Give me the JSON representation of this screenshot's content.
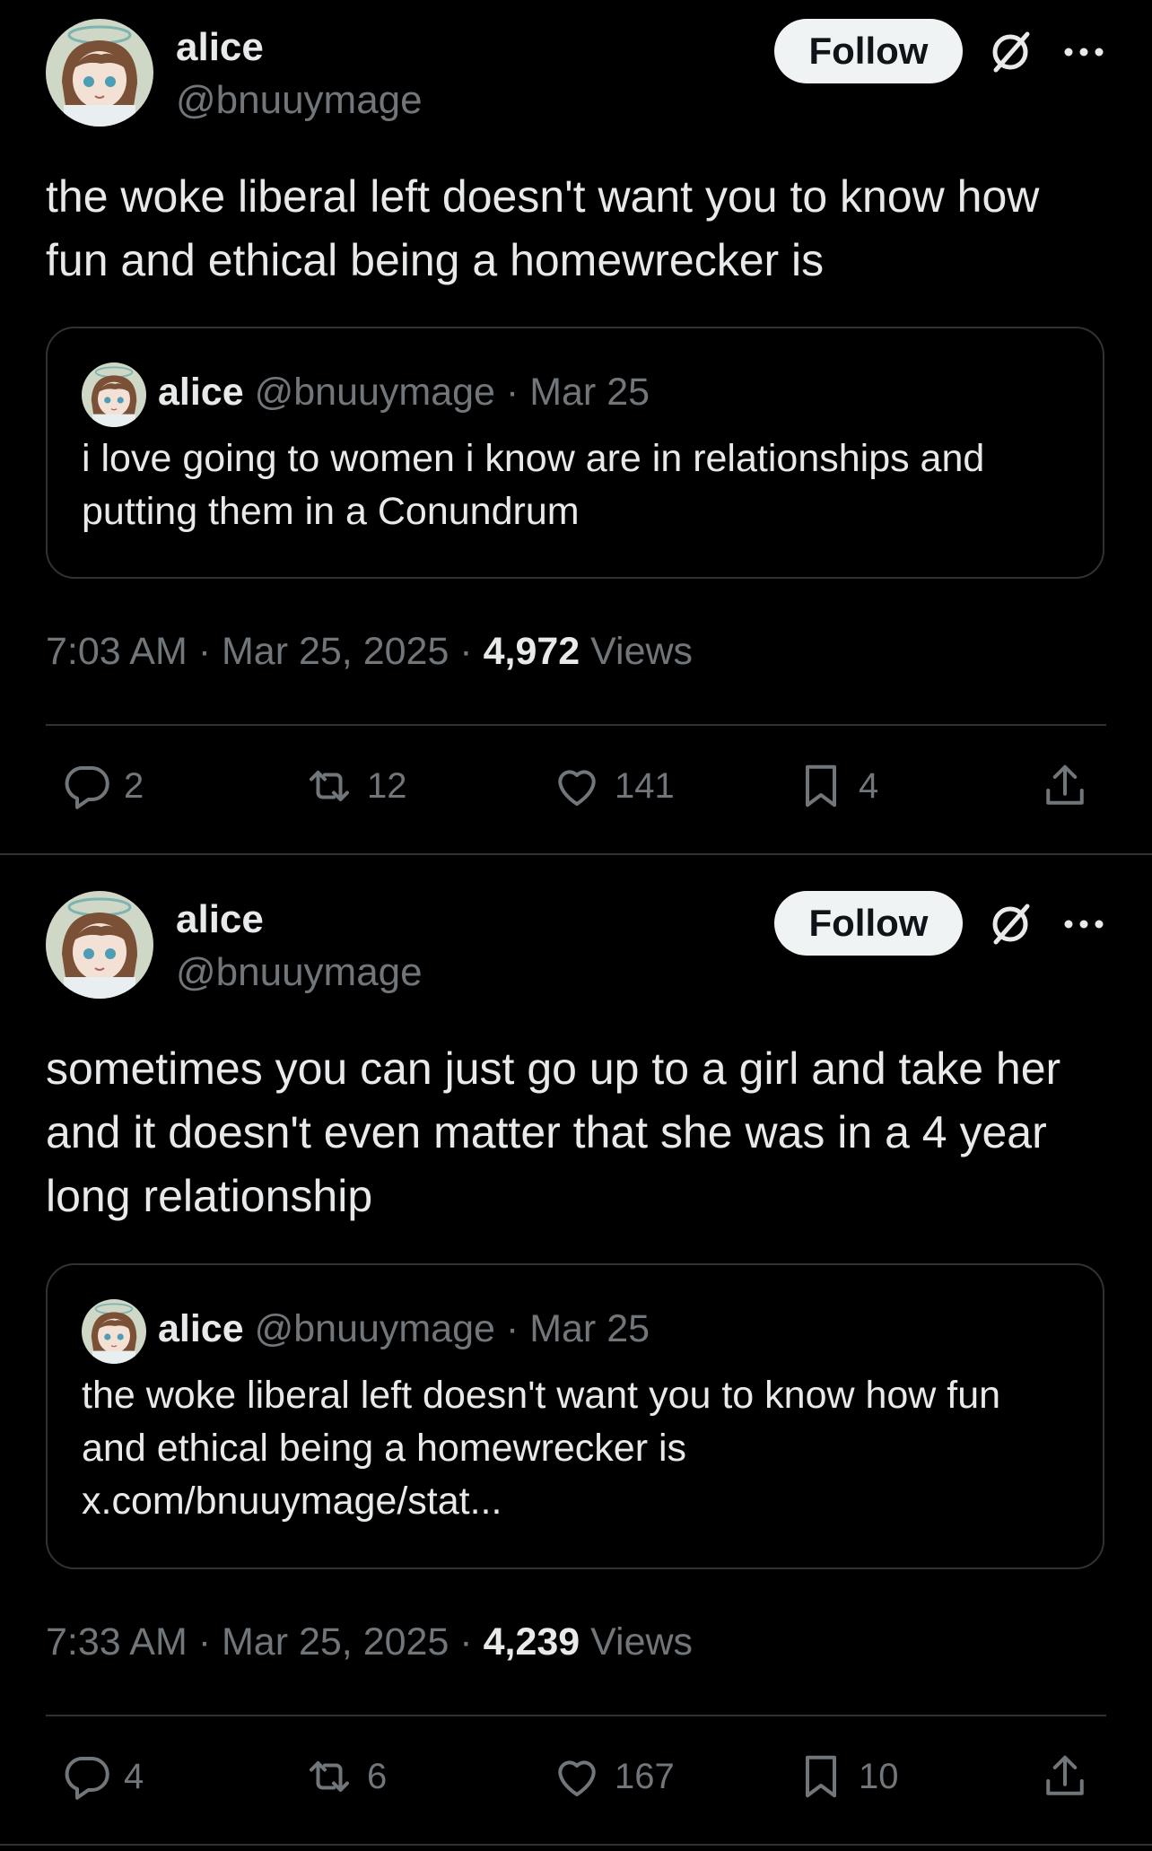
{
  "colors": {
    "background": "#000000",
    "text": "#e7e9ea",
    "muted": "#71767b",
    "border": "#2f3336",
    "follow_bg": "#eff3f4"
  },
  "posts": [
    {
      "name": "alice",
      "handle": "@bnuuymage",
      "follow_label": "Follow",
      "text": "the woke liberal left doesn't want you to know how fun and ethical being a homewrecker is",
      "quote": {
        "name": "alice",
        "handle": "@bnuuymage",
        "date": "· Mar 25",
        "text": "i love going to women i know are in relationships and putting them in a Conundrum"
      },
      "time": "7:03 AM · Mar 25, 2025 · ",
      "views_count": "4,972",
      "views_label": " Views",
      "replies": "2",
      "reposts": "12",
      "likes": "141",
      "bookmarks": "4"
    },
    {
      "name": "alice",
      "handle": "@bnuuymage",
      "follow_label": "Follow",
      "text": "sometimes you can just go up to a girl and take her and it doesn't even matter that she was in a 4 year long relationship",
      "quote": {
        "name": "alice",
        "handle": "@bnuuymage",
        "date": "· Mar 25",
        "text": "the woke liberal left doesn't want you to know how fun and ethical being a homewrecker is x.com/bnuuymage/stat..."
      },
      "time": "7:33 AM · Mar 25, 2025 · ",
      "views_count": "4,239",
      "views_label": " Views",
      "replies": "4",
      "reposts": "6",
      "likes": "167",
      "bookmarks": "10"
    }
  ],
  "icons": [
    "avatar-image",
    "grok-icon",
    "more-icon",
    "reply-icon",
    "repost-icon",
    "like-icon",
    "bookmark-icon",
    "share-icon"
  ]
}
